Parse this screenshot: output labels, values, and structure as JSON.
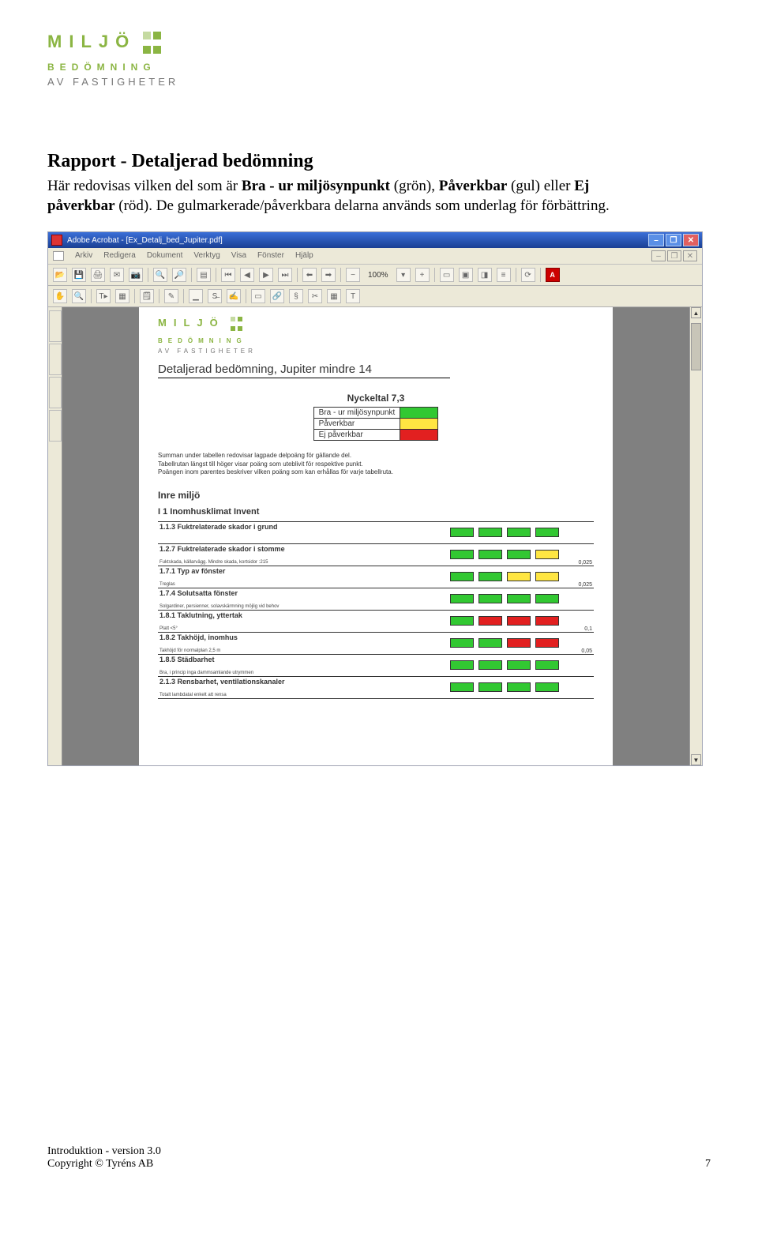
{
  "logo": {
    "line1": "MILJÖ",
    "line2": "BEDÖMNING",
    "line3": "AV FASTIGHETER"
  },
  "heading": "Rapport - Detaljerad bedömning",
  "paragraph": {
    "p1a": "Här redovisas vilken del som är ",
    "bra": "Bra - ur miljösynpunkt",
    "p1b": " (grön), ",
    "pav": "Påverkbar",
    "p1c": " (gul) eller ",
    "ej": "Ej påverkbar",
    "p1d": " (röd). De gulmarkerade/påverkbara delarna används som underlag för förbättring."
  },
  "acrobat": {
    "title": "Adobe Acrobat - [Ex_Detalj_bed_Jupiter.pdf]",
    "menus": [
      "Arkiv",
      "Redigera",
      "Dokument",
      "Verktyg",
      "Visa",
      "Fönster",
      "Hjälp"
    ],
    "zoom": "100%"
  },
  "pdf": {
    "title": "Detaljerad bedömning, Jupiter mindre 14",
    "nyckeltal_label": "Nyckeltal 7,3",
    "legend": [
      {
        "label": "Bra - ur miljösynpunkt",
        "color": "#32c832"
      },
      {
        "label": "Påverkbar",
        "color": "#ffe642"
      },
      {
        "label": "Ej påverkbar",
        "color": "#e22020"
      }
    ],
    "note_lines": [
      "Summan under tabellen redovisar lagpade delpoäng för gällande del.",
      "Tabellrutan längst till höger visar poäng som uteblivit för respektive punkt.",
      "Poängen inom parentes beskriver vilken poäng som kan erhållas för varje tabellruta."
    ],
    "section_h1": "Inre miljö",
    "section_h2": "I 1 Inomhusklimat Invent",
    "rows": [
      {
        "title": "1.1.3 Fuktrelaterade skador i grund",
        "sub": "",
        "cells": [
          "#32c832",
          "#32c832",
          "#32c832",
          "#32c832"
        ],
        "score": ""
      },
      {
        "title": "1.2.7 Fuktrelaterade skador i stomme",
        "sub": "Fuktskada, källarvägg. Mindre skada, kortsidor :215",
        "cells": [
          "#32c832",
          "#32c832",
          "#32c832",
          "#ffe642"
        ],
        "score": "0,025"
      },
      {
        "title": "1.7.1 Typ av fönster",
        "sub": "Treglas",
        "cells": [
          "#32c832",
          "#32c832",
          "#ffe642",
          "#ffe642"
        ],
        "score": "0,025"
      },
      {
        "title": "1.7.4 Solutsatta fönster",
        "sub": "Solgardiner, persienner, solavskärmning möjlig vid behov",
        "cells": [
          "#32c832",
          "#32c832",
          "#32c832",
          "#32c832"
        ],
        "score": ""
      },
      {
        "title": "1.8.1 Taklutning, yttertak",
        "sub": "Platt <5°",
        "cells": [
          "#32c832",
          "#e22020",
          "#e22020",
          "#e22020"
        ],
        "score": "0,1"
      },
      {
        "title": "1.8.2 Takhöjd, inomhus",
        "sub": "Takhöjd för normalplan 2,5 m",
        "cells": [
          "#32c832",
          "#32c832",
          "#e22020",
          "#e22020"
        ],
        "score": "0,05"
      },
      {
        "title": "1.8.5 Städbarhet",
        "sub": "Bra, i princip inga dammsamlande utrymmen",
        "cells": [
          "#32c832",
          "#32c832",
          "#32c832",
          "#32c832"
        ],
        "score": ""
      },
      {
        "title": "2.1.3 Rensbarhet, ventilationskanaler",
        "sub": "Totalt lambdatal enkelt att rensa",
        "cells": [
          "#32c832",
          "#32c832",
          "#32c832",
          "#32c832"
        ],
        "score": ""
      }
    ]
  },
  "footer": {
    "left1": "Introduktion - version 3.0",
    "left2": "Copyright © Tyréns AB",
    "pageno": "7"
  },
  "colors": {
    "green": "#32c832",
    "yellow": "#ffe642",
    "red": "#e22020"
  }
}
